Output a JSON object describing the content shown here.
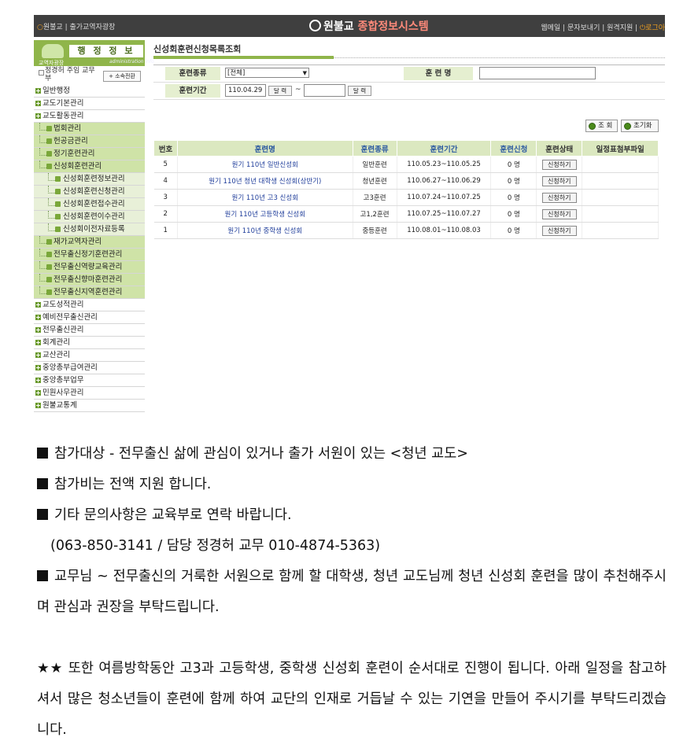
{
  "topbar": {
    "left_links": [
      "원불교",
      "출가교역자광장"
    ],
    "logo_prefix": "원불교",
    "logo_suffix": "종합정보시스템",
    "right_links": [
      "웹메일",
      "문자보내기",
      "원격지원"
    ],
    "logout": "로그아"
  },
  "sidebar": {
    "header_small": "교역자광장",
    "header_title": "행 정 정 보",
    "header_sub": "administration info",
    "user_name": "정경허 주임 교무부",
    "user_button": "+ 소속전환",
    "items": [
      {
        "level": 1,
        "label": "일반행정"
      },
      {
        "level": 1,
        "label": "교도기본관리"
      },
      {
        "level": 1,
        "label": "교도활동관리"
      },
      {
        "level": 2,
        "label": "법회관리"
      },
      {
        "level": 2,
        "label": "헌공금관리"
      },
      {
        "level": 2,
        "label": "정기훈련관리"
      },
      {
        "level": 2,
        "label": "신성회훈련관리"
      },
      {
        "level": 3,
        "label": "신성회훈련정보관리"
      },
      {
        "level": 3,
        "label": "신성회훈련신청관리"
      },
      {
        "level": 3,
        "label": "신성회훈련접수관리"
      },
      {
        "level": 3,
        "label": "신성회훈련이수관리"
      },
      {
        "level": 3,
        "label": "신성회이전자료등록"
      },
      {
        "level": 2,
        "label": "재가교역자관리"
      },
      {
        "level": 2,
        "label": "전무출신정기훈련관리"
      },
      {
        "level": 2,
        "label": "전무출신역량교육관리"
      },
      {
        "level": 2,
        "label": "전무출신향마훈련관리"
      },
      {
        "level": 2,
        "label": "전무출신지역훈련관리"
      },
      {
        "level": 1,
        "label": "교도성적관리"
      },
      {
        "level": 1,
        "label": "예비전무출신관리"
      },
      {
        "level": 1,
        "label": "전무출신관리"
      },
      {
        "level": 1,
        "label": "회계관리"
      },
      {
        "level": 1,
        "label": "교산관리"
      },
      {
        "level": 1,
        "label": "중앙총부급여관리"
      },
      {
        "level": 1,
        "label": "중앙총부업무"
      },
      {
        "level": 1,
        "label": "민원사무관리"
      },
      {
        "level": 1,
        "label": "원불교통계"
      }
    ]
  },
  "main": {
    "page_title": "신성회훈련신청목록조회",
    "search": {
      "type_label": "훈련종류",
      "type_value": "[전체]",
      "name_label": "훈 련 명",
      "name_value": "",
      "period_label": "훈련기간",
      "date_from": "110.04.29",
      "date_to": "",
      "calendar_label": "달 력",
      "tilde": "~",
      "search_button": "조 회",
      "reset_button": "초기화"
    },
    "table": {
      "headers": [
        "번호",
        "훈련명",
        "훈련종류",
        "훈련기간",
        "훈련신청",
        "훈련상태",
        "일정표첨부파일"
      ],
      "rows": [
        {
          "no": "5",
          "name": "원기 110년 일반신성회",
          "type": "일반훈련",
          "period": "110.05.23~110.05.25",
          "applied": "0 명",
          "status": "신청하기",
          "file": ""
        },
        {
          "no": "4",
          "name": "원기 110년 청년 대학생 신성회(상반기)",
          "type": "청년훈련",
          "period": "110.06.27~110.06.29",
          "applied": "0 명",
          "status": "신청하기",
          "file": ""
        },
        {
          "no": "3",
          "name": "원기 110년 고3 신성회",
          "type": "고3훈련",
          "period": "110.07.24~110.07.25",
          "applied": "0 명",
          "status": "신청하기",
          "file": ""
        },
        {
          "no": "2",
          "name": "원기 110년 고등학생 신성회",
          "type": "고1,2훈련",
          "period": "110.07.25~110.07.27",
          "applied": "0 명",
          "status": "신청하기",
          "file": ""
        },
        {
          "no": "1",
          "name": "원기 110년 중학생 신성회",
          "type": "중등훈련",
          "period": "110.08.01~110.08.03",
          "applied": "0 명",
          "status": "신청하기",
          "file": ""
        }
      ]
    }
  },
  "description": {
    "line1": "참가대상 - 전무출신 삶에 관심이 있거나 출가 서원이 있는 <청년 교도>",
    "line2": "참가비는 전액 지원 합니다.",
    "line3": "기타 문의사항은 교육부로 연락 바랍니다.",
    "line4": "(063-850-3141 / 담당 정경허 교무 010-4874-5363)",
    "line5": "교무님 ~ 전무출신의 거룩한 서원으로 함께 할 대학생, 청년 교도님께 청년 신성회 훈련을 많이 추천해주시며 관심과 권장을 부탁드립니다.",
    "line6": "★★ 또한 여름방학동안 고3과 고등학생, 중학생 신성회 훈련이 순서대로 진행이 됩니다. 아래 일정을 참고하셔서 많은 청소년들이 훈련에 함께 하여 교단의 인재로 거듭날 수 있는 기연을 만들어 주시기를 부탁드리겠습니다."
  }
}
